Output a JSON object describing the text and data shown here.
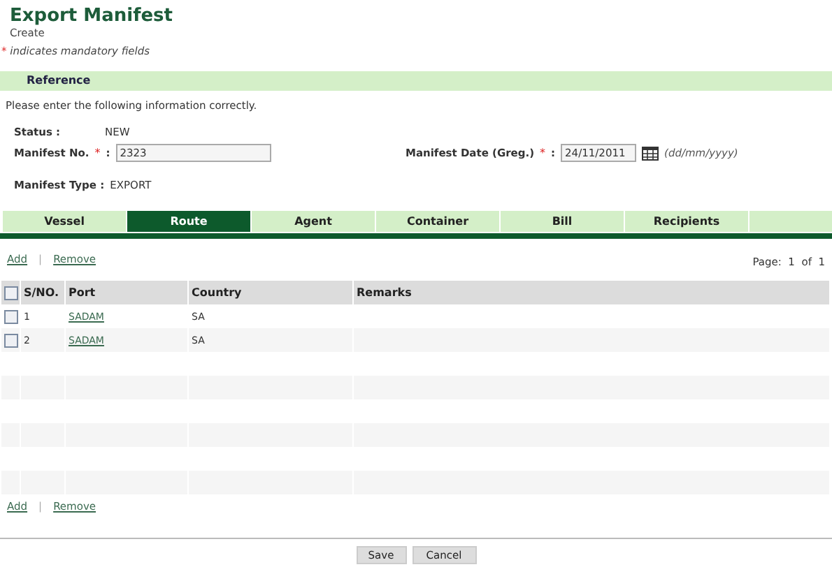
{
  "header": {
    "title": "Export Manifest",
    "subtitle": "Create",
    "mandatory_mark": "*",
    "mandatory_note": "indicates mandatory fields"
  },
  "section": {
    "title": "Reference",
    "instruction": "Please enter the following information correctly."
  },
  "fields": {
    "status": {
      "label": "Status :",
      "value": "NEW"
    },
    "manifest_no": {
      "label": "Manifest No.",
      "required_mark": "*",
      "colon": ":",
      "value": "2323"
    },
    "manifest_date": {
      "label": "Manifest Date (Greg.)",
      "required_mark": "*",
      "colon": ":",
      "value": "24/11/2011",
      "hint": "(dd/mm/yyyy)"
    },
    "manifest_type": {
      "label": "Manifest Type :",
      "value": "EXPORT"
    }
  },
  "tabs": [
    {
      "label": "Vessel",
      "selected": false
    },
    {
      "label": "Route",
      "selected": true
    },
    {
      "label": "Agent",
      "selected": false
    },
    {
      "label": "Container",
      "selected": false
    },
    {
      "label": "Bill",
      "selected": false
    },
    {
      "label": "Recipients",
      "selected": false
    }
  ],
  "toolbar_top": {
    "add": "Add",
    "separator": "|",
    "remove": "Remove",
    "page": "Page:  1  of  1"
  },
  "table": {
    "select_all_checked": false,
    "columns": [
      "S/NO.",
      "Port",
      "Country",
      "Remarks"
    ],
    "rows": [
      {
        "checked": false,
        "sno": "1",
        "port": "SADAM",
        "country": "SA"
      },
      {
        "checked": false,
        "sno": "2",
        "port": "SADAM",
        "country": "SA"
      }
    ]
  },
  "toolbar_bottom": {
    "add": "Add",
    "separator": "|",
    "remove": "Remove"
  },
  "buttons": [
    "Save",
    "Cancel"
  ]
}
